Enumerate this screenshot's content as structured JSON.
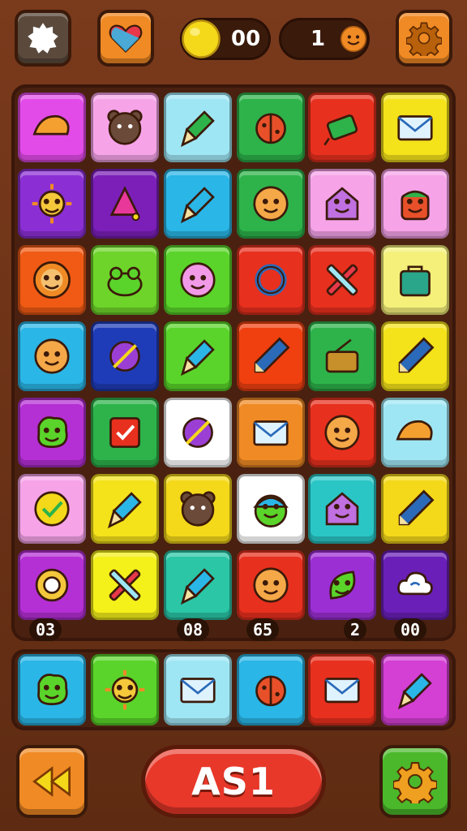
{
  "top_bar": {
    "menu_icon": "gear-badge-icon",
    "heart_icon": "heart-icon",
    "coins_value": "00",
    "lives_value": "1",
    "settings_icon": "gear-icon",
    "colors": {
      "menu": "#5b4a3c",
      "heart": "#f08a24",
      "settings": "#f08a24"
    }
  },
  "board": {
    "rows": [
      [
        {
          "color": "#e24be8",
          "icon": "fortune-cookie-icon"
        },
        {
          "color": "#f6a3e8",
          "icon": "bear-face-icon"
        },
        {
          "color": "#9fe6f4",
          "icon": "paintbrush-icon"
        },
        {
          "color": "#2db34a",
          "icon": "ladybug-icon"
        },
        {
          "color": "#e8301e",
          "icon": "cannon-icon"
        },
        {
          "color": "#f4e21a",
          "icon": "envelope-icon"
        }
      ],
      [
        {
          "color": "#8b2fd4",
          "icon": "sun-face-icon"
        },
        {
          "color": "#7b1fb8",
          "icon": "bell-icon"
        },
        {
          "color": "#2ab6e6",
          "icon": "brush-icon"
        },
        {
          "color": "#2db34a",
          "icon": "smiley-icon"
        },
        {
          "color": "#f6a3e8",
          "icon": "house-face-icon"
        },
        {
          "color": "#f6a3e8",
          "icon": "pot-face-icon"
        }
      ],
      [
        {
          "color": "#f05a14",
          "icon": "lion-face-icon"
        },
        {
          "color": "#6ed42a",
          "icon": "frog-icon"
        },
        {
          "color": "#5ad42a",
          "icon": "flower-face-icon"
        },
        {
          "color": "#e8301e",
          "icon": "ring-icon"
        },
        {
          "color": "#e8301e",
          "icon": "cross-stick-icon"
        },
        {
          "color": "#f4f07a",
          "icon": "bag-icon"
        }
      ],
      [
        {
          "color": "#2ab6e6",
          "icon": "smiley-icon"
        },
        {
          "color": "#1f3cb8",
          "icon": "compass-icon"
        },
        {
          "color": "#5ad42a",
          "icon": "brush-icon"
        },
        {
          "color": "#f04010",
          "icon": "pencil-icon"
        },
        {
          "color": "#2db34a",
          "icon": "basket-icon"
        },
        {
          "color": "#f4e21a",
          "icon": "pencil-icon"
        }
      ],
      [
        {
          "color": "#b42fd4",
          "icon": "blob-face-icon"
        },
        {
          "color": "#2db34a",
          "icon": "checkbox-icon"
        },
        {
          "color": "#ffffff",
          "icon": "compass-icon"
        },
        {
          "color": "#f08a24",
          "icon": "envelope-icon"
        },
        {
          "color": "#e8301e",
          "icon": "smiley-icon"
        },
        {
          "color": "#9fe6f4",
          "icon": "fortune-cookie-icon"
        }
      ],
      [
        {
          "color": "#f6a3e8",
          "icon": "check-badge-icon"
        },
        {
          "color": "#f4e21a",
          "icon": "brush-icon"
        },
        {
          "color": "#f4d81a",
          "icon": "bear-face-icon"
        },
        {
          "color": "#ffffff",
          "icon": "smiley-cap-icon"
        },
        {
          "color": "#2ac6c6",
          "icon": "house-face-icon"
        },
        {
          "color": "#f4d81a",
          "icon": "pencil-icon"
        }
      ],
      [
        {
          "color": "#b42fd4",
          "icon": "target-icon"
        },
        {
          "color": "#f4f01a",
          "icon": "cross-stick-icon"
        },
        {
          "color": "#2ac6a6",
          "icon": "brush-icon"
        },
        {
          "color": "#e8301e",
          "icon": "smiley-icon"
        },
        {
          "color": "#9b2fd4",
          "icon": "leaf-face-icon"
        },
        {
          "color": "#6a1fb8",
          "icon": "cloud-icon"
        }
      ]
    ],
    "labels": [
      "03",
      "08",
      "65",
      "2",
      "00"
    ]
  },
  "tray": {
    "items": [
      {
        "color": "#2ab6e6",
        "icon": "blob-face-icon"
      },
      {
        "color": "#5ad42a",
        "icon": "sun-face-icon"
      },
      {
        "color": "#9fe6f4",
        "icon": "envelope-icon"
      },
      {
        "color": "#2ab6e6",
        "icon": "ladybug-icon"
      },
      {
        "color": "#e8301e",
        "icon": "envelope-icon"
      },
      {
        "color": "#d43fd4",
        "icon": "brush-icon"
      }
    ]
  },
  "bottom_bar": {
    "back_icon": "rewind-icon",
    "main_button_label": "AS1",
    "settings_icon": "gear-icon",
    "colors": {
      "back": "#f08a24",
      "main": "#e8382a",
      "settings": "#4ab82a"
    }
  }
}
